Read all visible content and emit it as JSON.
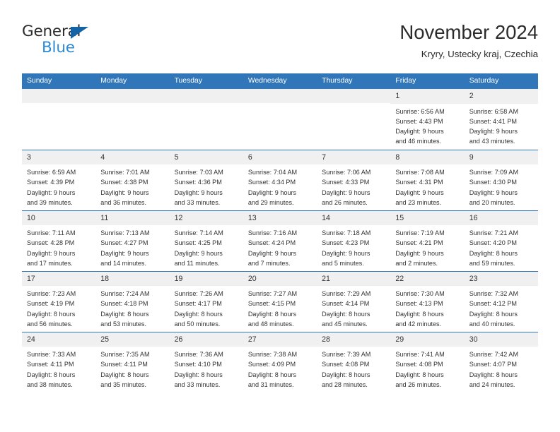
{
  "brand": {
    "word_one": "General",
    "word_two": "Blue",
    "triangle_color": "#1464a5",
    "blue_color": "#2e8ad4"
  },
  "header": {
    "month_title": "November 2024",
    "location": "Kryry, Ustecky kraj, Czechia"
  },
  "theme": {
    "header_blue": "#3176b8",
    "daynum_band": "#f0f0f0",
    "text": "#333333"
  },
  "weekdays": [
    "Sunday",
    "Monday",
    "Tuesday",
    "Wednesday",
    "Thursday",
    "Friday",
    "Saturday"
  ],
  "labels": {
    "sunrise_prefix": "Sunrise: ",
    "sunset_prefix": "Sunset: ",
    "daylight_prefix": "Daylight: "
  },
  "weeks": [
    [
      {
        "day": "",
        "empty": true
      },
      {
        "day": "",
        "empty": true
      },
      {
        "day": "",
        "empty": true
      },
      {
        "day": "",
        "empty": true
      },
      {
        "day": "",
        "empty": true
      },
      {
        "day": "1",
        "sunrise": "Sunrise: 6:56 AM",
        "sunset": "Sunset: 4:43 PM",
        "daylight_1": "Daylight: 9 hours",
        "daylight_2": "and 46 minutes."
      },
      {
        "day": "2",
        "sunrise": "Sunrise: 6:58 AM",
        "sunset": "Sunset: 4:41 PM",
        "daylight_1": "Daylight: 9 hours",
        "daylight_2": "and 43 minutes."
      }
    ],
    [
      {
        "day": "3",
        "sunrise": "Sunrise: 6:59 AM",
        "sunset": "Sunset: 4:39 PM",
        "daylight_1": "Daylight: 9 hours",
        "daylight_2": "and 39 minutes."
      },
      {
        "day": "4",
        "sunrise": "Sunrise: 7:01 AM",
        "sunset": "Sunset: 4:38 PM",
        "daylight_1": "Daylight: 9 hours",
        "daylight_2": "and 36 minutes."
      },
      {
        "day": "5",
        "sunrise": "Sunrise: 7:03 AM",
        "sunset": "Sunset: 4:36 PM",
        "daylight_1": "Daylight: 9 hours",
        "daylight_2": "and 33 minutes."
      },
      {
        "day": "6",
        "sunrise": "Sunrise: 7:04 AM",
        "sunset": "Sunset: 4:34 PM",
        "daylight_1": "Daylight: 9 hours",
        "daylight_2": "and 29 minutes."
      },
      {
        "day": "7",
        "sunrise": "Sunrise: 7:06 AM",
        "sunset": "Sunset: 4:33 PM",
        "daylight_1": "Daylight: 9 hours",
        "daylight_2": "and 26 minutes."
      },
      {
        "day": "8",
        "sunrise": "Sunrise: 7:08 AM",
        "sunset": "Sunset: 4:31 PM",
        "daylight_1": "Daylight: 9 hours",
        "daylight_2": "and 23 minutes."
      },
      {
        "day": "9",
        "sunrise": "Sunrise: 7:09 AM",
        "sunset": "Sunset: 4:30 PM",
        "daylight_1": "Daylight: 9 hours",
        "daylight_2": "and 20 minutes."
      }
    ],
    [
      {
        "day": "10",
        "sunrise": "Sunrise: 7:11 AM",
        "sunset": "Sunset: 4:28 PM",
        "daylight_1": "Daylight: 9 hours",
        "daylight_2": "and 17 minutes."
      },
      {
        "day": "11",
        "sunrise": "Sunrise: 7:13 AM",
        "sunset": "Sunset: 4:27 PM",
        "daylight_1": "Daylight: 9 hours",
        "daylight_2": "and 14 minutes."
      },
      {
        "day": "12",
        "sunrise": "Sunrise: 7:14 AM",
        "sunset": "Sunset: 4:25 PM",
        "daylight_1": "Daylight: 9 hours",
        "daylight_2": "and 11 minutes."
      },
      {
        "day": "13",
        "sunrise": "Sunrise: 7:16 AM",
        "sunset": "Sunset: 4:24 PM",
        "daylight_1": "Daylight: 9 hours",
        "daylight_2": "and 7 minutes."
      },
      {
        "day": "14",
        "sunrise": "Sunrise: 7:18 AM",
        "sunset": "Sunset: 4:23 PM",
        "daylight_1": "Daylight: 9 hours",
        "daylight_2": "and 5 minutes."
      },
      {
        "day": "15",
        "sunrise": "Sunrise: 7:19 AM",
        "sunset": "Sunset: 4:21 PM",
        "daylight_1": "Daylight: 9 hours",
        "daylight_2": "and 2 minutes."
      },
      {
        "day": "16",
        "sunrise": "Sunrise: 7:21 AM",
        "sunset": "Sunset: 4:20 PM",
        "daylight_1": "Daylight: 8 hours",
        "daylight_2": "and 59 minutes."
      }
    ],
    [
      {
        "day": "17",
        "sunrise": "Sunrise: 7:23 AM",
        "sunset": "Sunset: 4:19 PM",
        "daylight_1": "Daylight: 8 hours",
        "daylight_2": "and 56 minutes."
      },
      {
        "day": "18",
        "sunrise": "Sunrise: 7:24 AM",
        "sunset": "Sunset: 4:18 PM",
        "daylight_1": "Daylight: 8 hours",
        "daylight_2": "and 53 minutes."
      },
      {
        "day": "19",
        "sunrise": "Sunrise: 7:26 AM",
        "sunset": "Sunset: 4:17 PM",
        "daylight_1": "Daylight: 8 hours",
        "daylight_2": "and 50 minutes."
      },
      {
        "day": "20",
        "sunrise": "Sunrise: 7:27 AM",
        "sunset": "Sunset: 4:15 PM",
        "daylight_1": "Daylight: 8 hours",
        "daylight_2": "and 48 minutes."
      },
      {
        "day": "21",
        "sunrise": "Sunrise: 7:29 AM",
        "sunset": "Sunset: 4:14 PM",
        "daylight_1": "Daylight: 8 hours",
        "daylight_2": "and 45 minutes."
      },
      {
        "day": "22",
        "sunrise": "Sunrise: 7:30 AM",
        "sunset": "Sunset: 4:13 PM",
        "daylight_1": "Daylight: 8 hours",
        "daylight_2": "and 42 minutes."
      },
      {
        "day": "23",
        "sunrise": "Sunrise: 7:32 AM",
        "sunset": "Sunset: 4:12 PM",
        "daylight_1": "Daylight: 8 hours",
        "daylight_2": "and 40 minutes."
      }
    ],
    [
      {
        "day": "24",
        "sunrise": "Sunrise: 7:33 AM",
        "sunset": "Sunset: 4:11 PM",
        "daylight_1": "Daylight: 8 hours",
        "daylight_2": "and 38 minutes."
      },
      {
        "day": "25",
        "sunrise": "Sunrise: 7:35 AM",
        "sunset": "Sunset: 4:11 PM",
        "daylight_1": "Daylight: 8 hours",
        "daylight_2": "and 35 minutes."
      },
      {
        "day": "26",
        "sunrise": "Sunrise: 7:36 AM",
        "sunset": "Sunset: 4:10 PM",
        "daylight_1": "Daylight: 8 hours",
        "daylight_2": "and 33 minutes."
      },
      {
        "day": "27",
        "sunrise": "Sunrise: 7:38 AM",
        "sunset": "Sunset: 4:09 PM",
        "daylight_1": "Daylight: 8 hours",
        "daylight_2": "and 31 minutes."
      },
      {
        "day": "28",
        "sunrise": "Sunrise: 7:39 AM",
        "sunset": "Sunset: 4:08 PM",
        "daylight_1": "Daylight: 8 hours",
        "daylight_2": "and 28 minutes."
      },
      {
        "day": "29",
        "sunrise": "Sunrise: 7:41 AM",
        "sunset": "Sunset: 4:08 PM",
        "daylight_1": "Daylight: 8 hours",
        "daylight_2": "and 26 minutes."
      },
      {
        "day": "30",
        "sunrise": "Sunrise: 7:42 AM",
        "sunset": "Sunset: 4:07 PM",
        "daylight_1": "Daylight: 8 hours",
        "daylight_2": "and 24 minutes."
      }
    ]
  ]
}
